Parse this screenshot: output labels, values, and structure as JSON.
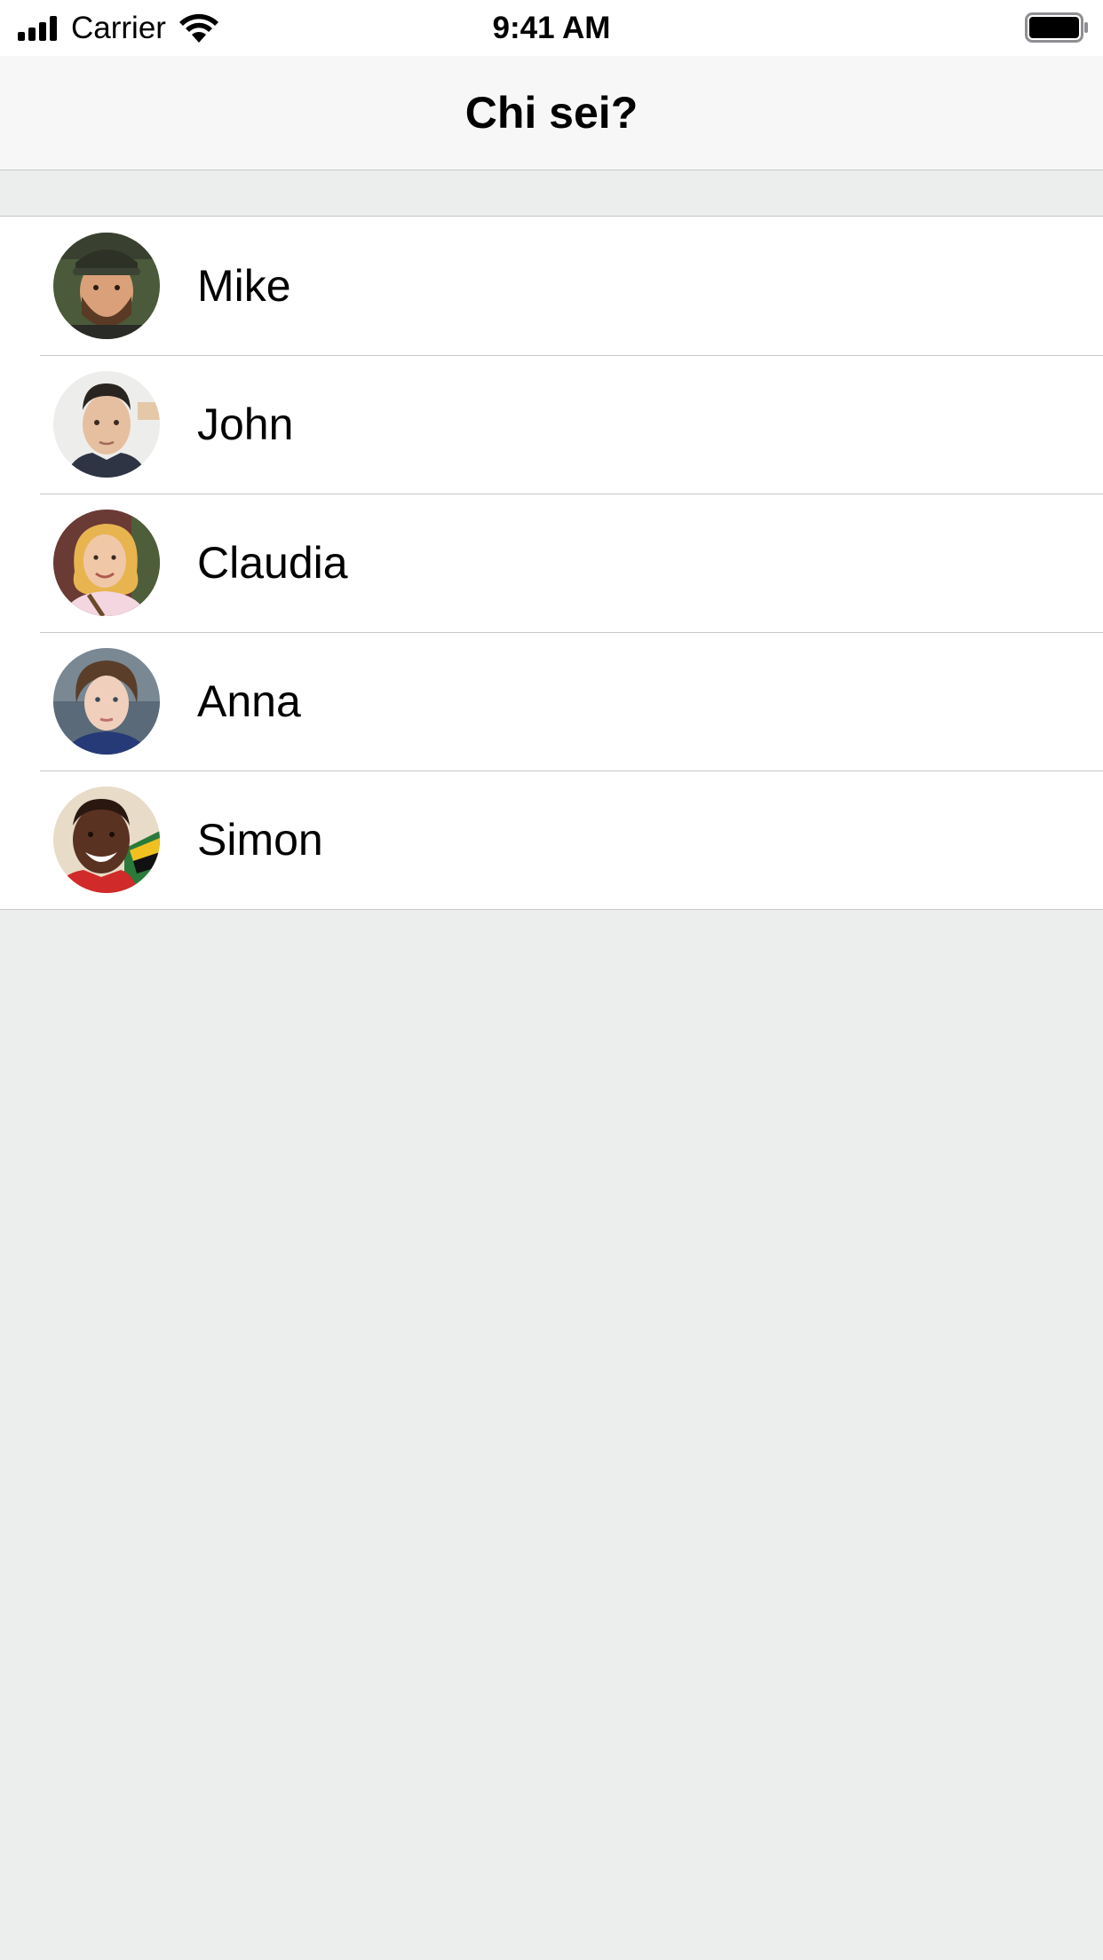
{
  "status_bar": {
    "carrier": "Carrier",
    "time": "9:41 AM",
    "signal_icon": "cellular-signal-icon",
    "wifi_icon": "wifi-icon",
    "battery_icon": "battery-icon"
  },
  "nav": {
    "title": "Chi sei?"
  },
  "users": [
    {
      "name": "Mike",
      "avatar": "avatar-photo-mike"
    },
    {
      "name": "John",
      "avatar": "avatar-photo-john"
    },
    {
      "name": "Claudia",
      "avatar": "avatar-photo-claudia"
    },
    {
      "name": "Anna",
      "avatar": "avatar-photo-anna"
    },
    {
      "name": "Simon",
      "avatar": "avatar-photo-simon"
    }
  ],
  "colors": {
    "background": "#ECEDED",
    "nav_background": "#F7F7F7",
    "separator": "#C8C8CC",
    "text": "#000000"
  }
}
